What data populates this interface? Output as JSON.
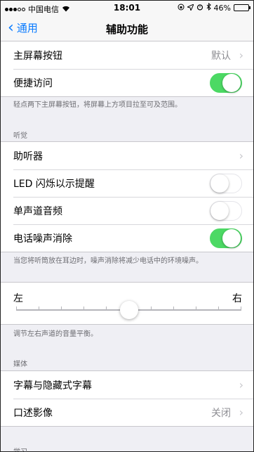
{
  "status_bar": {
    "carrier": "中国电信",
    "time": "18:01",
    "battery_percent": "46%",
    "battery_level": 0.46,
    "icons": [
      "wifi-icon",
      "lock-rotation-icon",
      "location-icon",
      "alarm-icon",
      "bluetooth-icon"
    ]
  },
  "nav": {
    "back_label": "通用",
    "title": "辅助功能"
  },
  "group1": {
    "home_button": {
      "label": "主屏幕按钮",
      "value": "默认"
    },
    "reachability": {
      "label": "便捷访问",
      "on": true
    }
  },
  "reachability_footnote": "轻点两下主屏幕按钮，将屏幕上方项目拉至可及范围。",
  "hearing": {
    "header": "听觉",
    "hearing_devices": {
      "label": "助听器"
    },
    "led_flash": {
      "label": "LED 闪烁以示提醒",
      "on": false
    },
    "mono_audio": {
      "label": "单声道音频",
      "on": false
    },
    "phone_noise_cancel": {
      "label": "电话噪声消除",
      "on": true
    }
  },
  "noise_footnote": "当您将听筒放在耳边时，噪声消除将减少电话中的环境噪声。",
  "balance": {
    "left_label": "左",
    "right_label": "右",
    "level": 0.5,
    "footnote": "调节左右声道的音量平衡。"
  },
  "media": {
    "header": "媒体",
    "subtitles": {
      "label": "字幕与隐藏式字幕"
    },
    "audio_descriptions": {
      "label": "口述影像",
      "value": "关闭"
    }
  },
  "learning": {
    "header": "学习"
  },
  "colors": {
    "accent": "#0a7bff",
    "toggle_on": "#4cd964"
  }
}
